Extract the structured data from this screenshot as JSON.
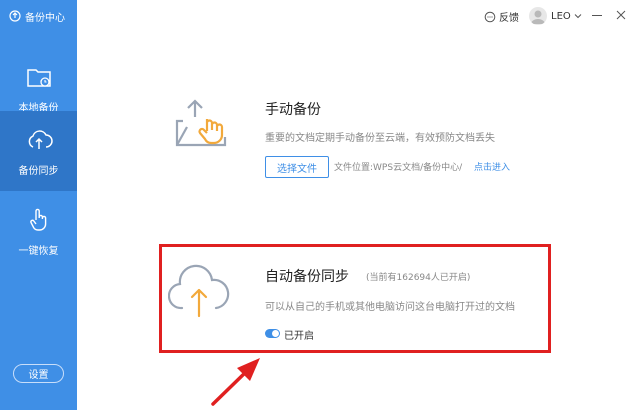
{
  "app": {
    "title": "备份中心"
  },
  "sidebar": {
    "items": [
      {
        "label": "本地备份",
        "icon": "folder-clock-icon"
      },
      {
        "label": "备份同步",
        "icon": "cloud-upload-icon",
        "active": true
      },
      {
        "label": "一键恢复",
        "icon": "hand-tap-icon"
      }
    ],
    "settings_label": "设置"
  },
  "topbar": {
    "feedback_label": "反馈",
    "user_name": "LEO"
  },
  "manual": {
    "title": "手动备份",
    "description": "重要的文档定期手动备份至云端，有效预防文档丢失",
    "choose_button": "选择文件",
    "path_label": "文件位置:WPS云文档/备份中心/",
    "path_link": "点击进入"
  },
  "auto": {
    "title": "自动备份同步",
    "count_text": "(当前有162694人已开启)",
    "description": "可以从自己的手机或其他电脑访问这台电脑打开过的文档",
    "toggle_label": "已开启",
    "toggle_on": true
  },
  "colors": {
    "accent": "#3f8fe6",
    "sidebar_active": "#2f76c8",
    "highlight": "#e02020",
    "illustration_orange": "#f2a93b"
  }
}
